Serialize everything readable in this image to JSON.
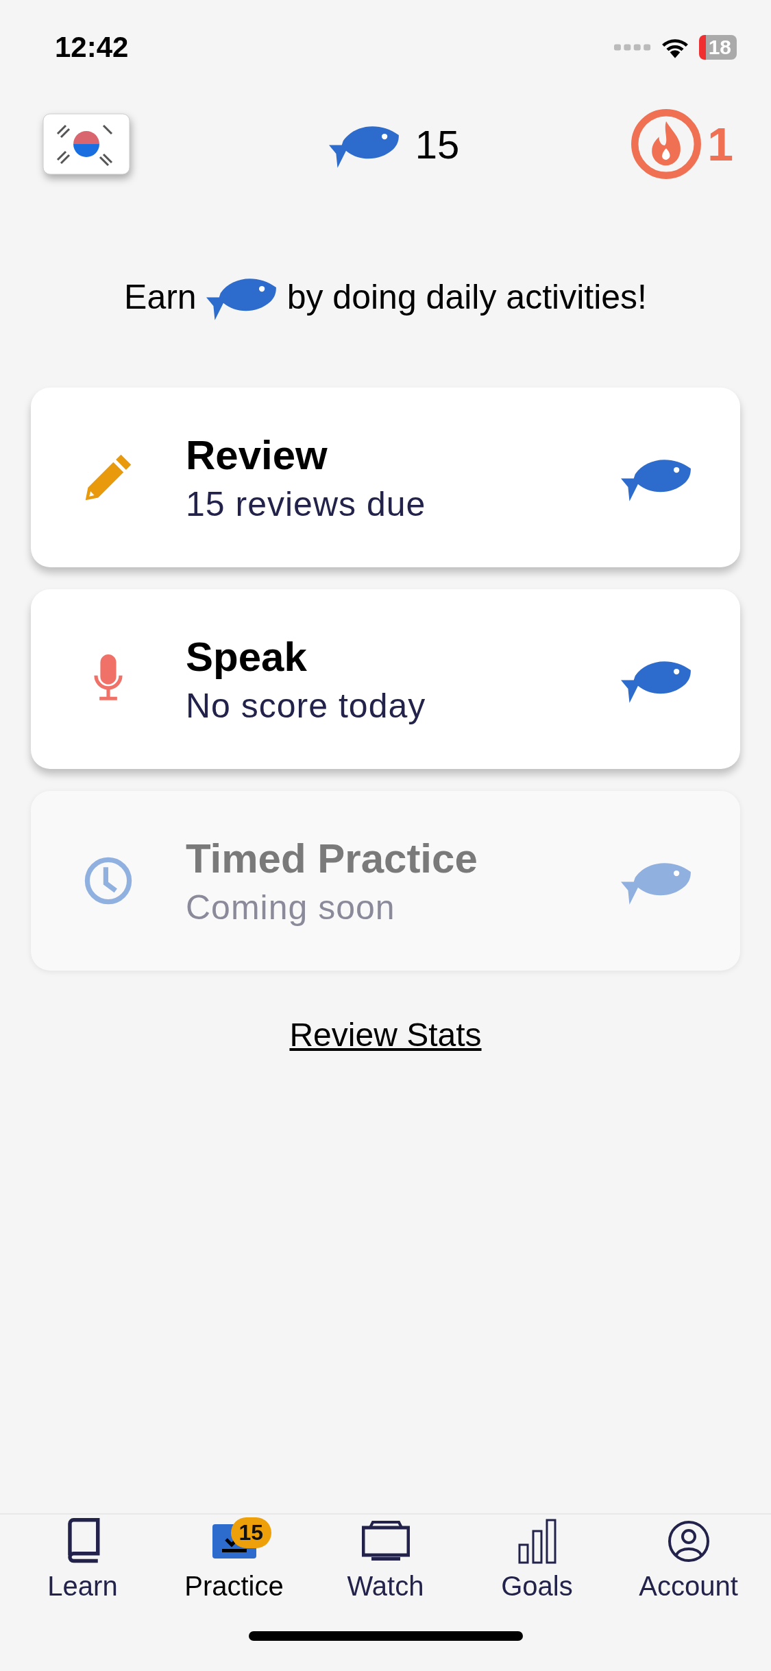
{
  "status_bar": {
    "time": "12:42",
    "battery": "18"
  },
  "header": {
    "fish_count": "15",
    "streak": "1"
  },
  "earn_message": {
    "before": "Earn",
    "after": "by doing daily activities!"
  },
  "activities": [
    {
      "kind": "pencil",
      "title": "Review",
      "subtitle": "15 reviews due",
      "disabled": false
    },
    {
      "kind": "mic",
      "title": "Speak",
      "subtitle": "No score today",
      "disabled": false
    },
    {
      "kind": "clock",
      "title": "Timed Practice",
      "subtitle": "Coming soon",
      "disabled": true
    }
  ],
  "review_stats_link": "Review Stats",
  "tab_bar": [
    {
      "kind": "book",
      "label": "Learn",
      "selected": false
    },
    {
      "kind": "practice",
      "label": "Practice",
      "selected": true,
      "badge": "15"
    },
    {
      "kind": "tv",
      "label": "Watch",
      "selected": false
    },
    {
      "kind": "bars",
      "label": "Goals",
      "selected": false
    },
    {
      "kind": "person",
      "label": "Account",
      "selected": false
    }
  ]
}
